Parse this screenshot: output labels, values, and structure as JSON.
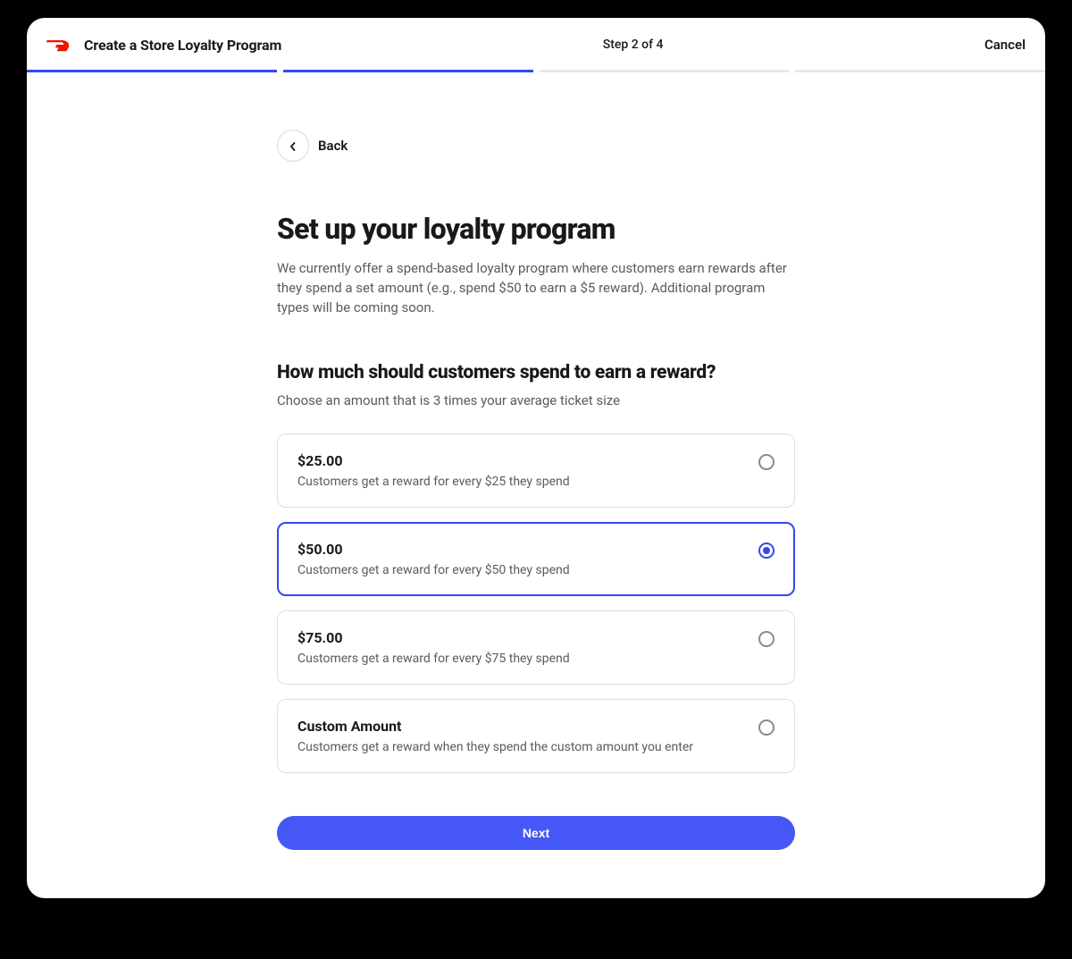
{
  "header": {
    "title": "Create a Store Loyalty Program",
    "step_label": "Step 2 of 4",
    "cancel_label": "Cancel"
  },
  "progress": {
    "total_segments": 4,
    "active_segments": 2
  },
  "back": {
    "label": "Back"
  },
  "page": {
    "title": "Set up your loyalty program",
    "description": "We currently offer a spend-based loyalty program where customers earn rewards after they spend a set amount (e.g., spend $50 to earn a $5 reward). Additional program types will be coming soon."
  },
  "section": {
    "title": "How much should customers spend to earn a reward?",
    "subtitle": "Choose an amount that is 3 times your average ticket size"
  },
  "options": [
    {
      "title": "$25.00",
      "description": "Customers get a reward for every $25 they spend",
      "selected": false
    },
    {
      "title": "$50.00",
      "description": "Customers get a reward for every $50 they spend",
      "selected": true
    },
    {
      "title": "$75.00",
      "description": "Customers get a reward for every $75 they spend",
      "selected": false
    },
    {
      "title": "Custom Amount",
      "description": "Customers get a reward when they spend the custom amount you enter",
      "selected": false
    }
  ],
  "colors": {
    "accent": "#3447ef",
    "brand": "#eb1700"
  },
  "footer": {
    "next_label": "Next"
  }
}
